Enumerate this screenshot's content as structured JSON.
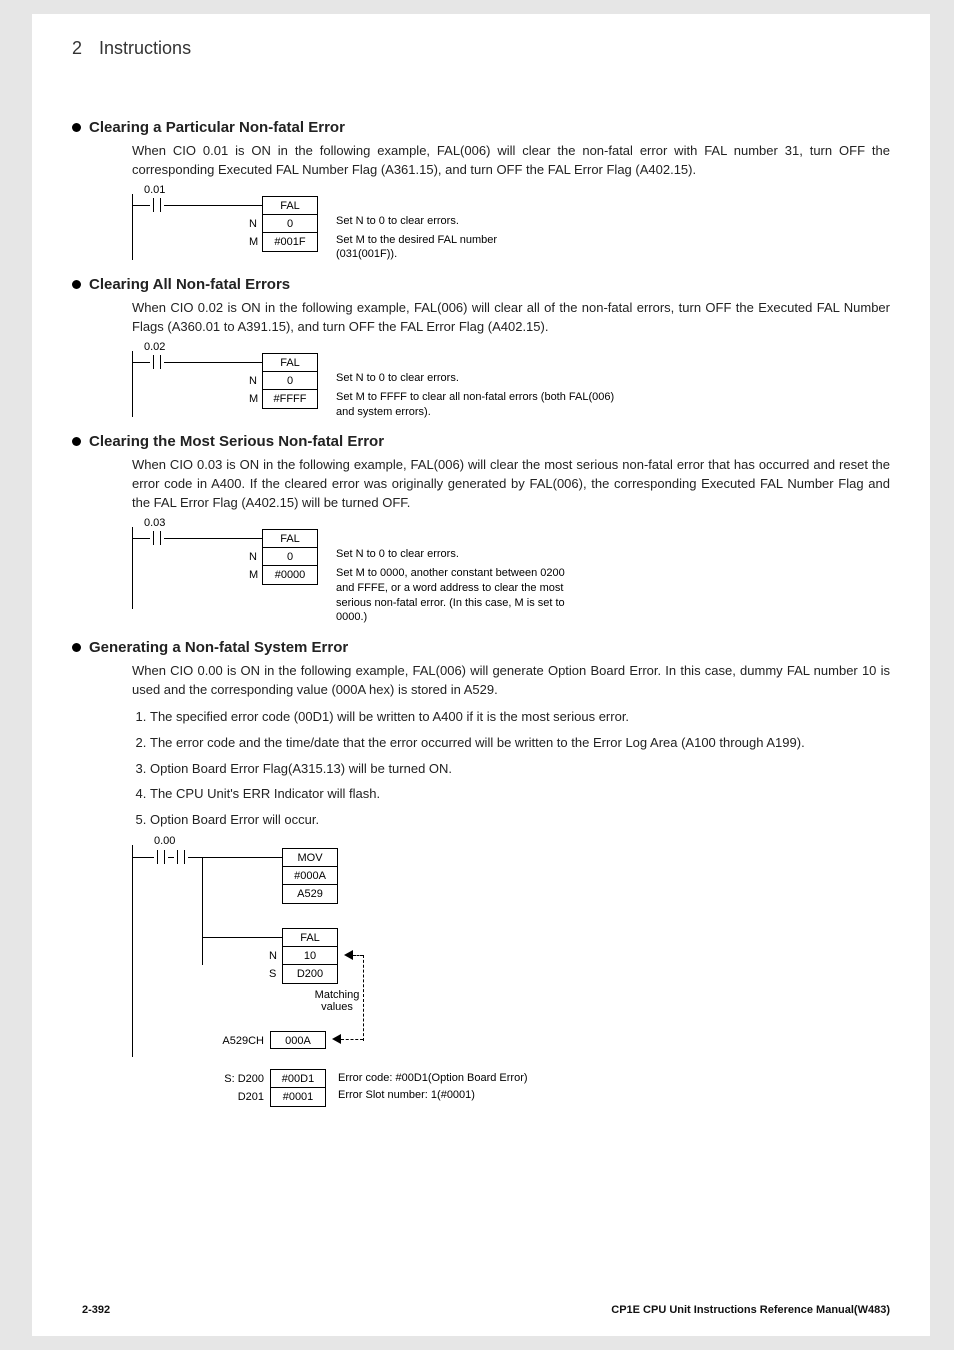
{
  "header": {
    "chapter_num": "2",
    "chapter_title": "Instructions"
  },
  "sections": [
    {
      "title": "Clearing a Particular Non-fatal Error",
      "body": "When CIO 0.01 is ON in the following example, FAL(006) will clear the non-fatal error with FAL number 31, turn OFF the corresponding Executed FAL Number Flag (A361.15), and turn OFF the FAL Error Flag (A402.15).",
      "ladder": {
        "rung": "0.01",
        "inst": "FAL",
        "rows": [
          {
            "lbl": "N",
            "val": "0"
          },
          {
            "lbl": "M",
            "val": "#001F"
          }
        ],
        "note1": "Set N to 0 to clear errors.",
        "note2": "Set M to the desired FAL number (031(001F))."
      }
    },
    {
      "title": "Clearing All Non-fatal Errors",
      "body": "When CIO 0.02 is ON in the following example, FAL(006) will clear all of the non-fatal errors, turn OFF the Executed FAL Number Flags (A360.01 to A391.15), and turn OFF the FAL Error Flag (A402.15).",
      "ladder": {
        "rung": "0.02",
        "inst": "FAL",
        "rows": [
          {
            "lbl": "N",
            "val": "0"
          },
          {
            "lbl": "M",
            "val": "#FFFF"
          }
        ],
        "note1": "Set N to 0 to clear errors.",
        "note2": "Set M to FFFF to clear all non-fatal errors (both FAL(006) and system errors)."
      }
    },
    {
      "title": "Clearing the Most Serious Non-fatal Error",
      "body": "When CIO 0.03 is ON in the following example, FAL(006) will clear the most serious non-fatal error that has occurred and reset the error code in A400. If the cleared error was originally generated by FAL(006), the corresponding Executed FAL Number Flag and the FAL Error Flag (A402.15) will be turned OFF.",
      "ladder": {
        "rung": "0.03",
        "inst": "FAL",
        "rows": [
          {
            "lbl": "N",
            "val": "0"
          },
          {
            "lbl": "M",
            "val": "#0000"
          }
        ],
        "note1": "Set N to 0 to clear errors.",
        "note2": "Set M to 0000, another constant between 0200 and FFFE, or a word address to clear the most serious non-fatal error. (In this case, M is set to 0000.)"
      }
    },
    {
      "title": "Generating a Non-fatal System Error",
      "body": "When CIO 0.00 is ON in the following example, FAL(006) will generate Option Board Error. In this case, dummy FAL number 10 is used and the corresponding value (000A hex) is stored in A529.",
      "list": [
        "The specified error code (00D1) will be written to A400 if it is the most serious error.",
        "The error code and the time/date that the error occurred will be written to the Error Log Area (A100 through A199).",
        "Option Board Error Flag(A315.13) will be turned ON.",
        "The CPU Unit's ERR Indicator will flash.",
        "Option Board Error will occur."
      ],
      "gen": {
        "rung": "0.00",
        "mov": {
          "inst": "MOV",
          "r1": "#000A",
          "r2": "A529"
        },
        "fal": {
          "inst": "FAL",
          "rN": {
            "lbl": "N",
            "val": "10"
          },
          "rS": {
            "lbl": "S",
            "val": "D200"
          }
        },
        "matching": "Matching values",
        "a529": {
          "lbl": "A529CH",
          "val": "000A"
        },
        "d200": {
          "lbl": "S: D200",
          "val": "#00D1",
          "note": "Error code: #00D1(Option Board Error)"
        },
        "d201": {
          "lbl": "D201",
          "val": "#0001",
          "note": "Error Slot number: 1(#0001)"
        }
      }
    }
  ],
  "footer": {
    "page": "2-392",
    "manual": "CP1E CPU Unit Instructions Reference Manual(W483)"
  }
}
